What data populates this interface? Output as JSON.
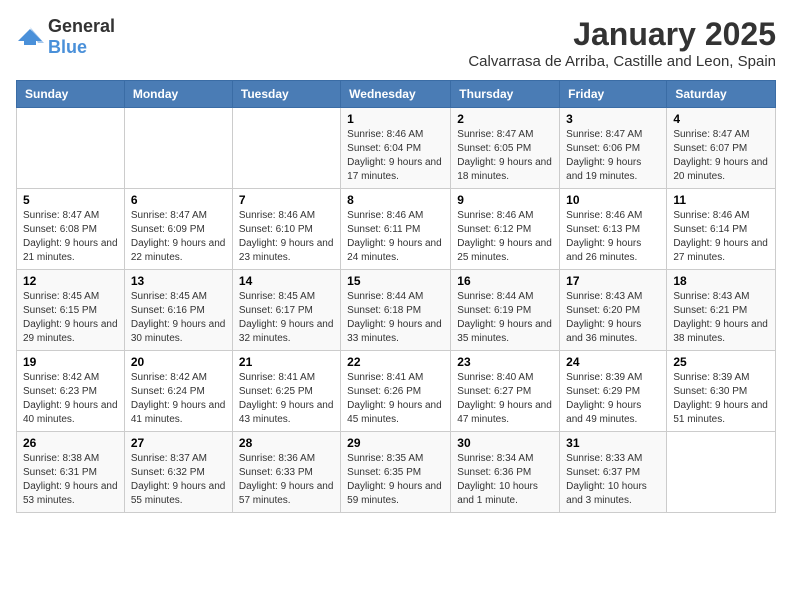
{
  "logo": {
    "general": "General",
    "blue": "Blue"
  },
  "header": {
    "month": "January 2025",
    "location": "Calvarrasa de Arriba, Castille and Leon, Spain"
  },
  "weekdays": [
    "Sunday",
    "Monday",
    "Tuesday",
    "Wednesday",
    "Thursday",
    "Friday",
    "Saturday"
  ],
  "weeks": [
    [
      {
        "day": "",
        "sunrise": "",
        "sunset": "",
        "daylight": ""
      },
      {
        "day": "",
        "sunrise": "",
        "sunset": "",
        "daylight": ""
      },
      {
        "day": "",
        "sunrise": "",
        "sunset": "",
        "daylight": ""
      },
      {
        "day": "1",
        "sunrise": "Sunrise: 8:46 AM",
        "sunset": "Sunset: 6:04 PM",
        "daylight": "Daylight: 9 hours and 17 minutes."
      },
      {
        "day": "2",
        "sunrise": "Sunrise: 8:47 AM",
        "sunset": "Sunset: 6:05 PM",
        "daylight": "Daylight: 9 hours and 18 minutes."
      },
      {
        "day": "3",
        "sunrise": "Sunrise: 8:47 AM",
        "sunset": "Sunset: 6:06 PM",
        "daylight": "Daylight: 9 hours and 19 minutes."
      },
      {
        "day": "4",
        "sunrise": "Sunrise: 8:47 AM",
        "sunset": "Sunset: 6:07 PM",
        "daylight": "Daylight: 9 hours and 20 minutes."
      }
    ],
    [
      {
        "day": "5",
        "sunrise": "Sunrise: 8:47 AM",
        "sunset": "Sunset: 6:08 PM",
        "daylight": "Daylight: 9 hours and 21 minutes."
      },
      {
        "day": "6",
        "sunrise": "Sunrise: 8:47 AM",
        "sunset": "Sunset: 6:09 PM",
        "daylight": "Daylight: 9 hours and 22 minutes."
      },
      {
        "day": "7",
        "sunrise": "Sunrise: 8:46 AM",
        "sunset": "Sunset: 6:10 PM",
        "daylight": "Daylight: 9 hours and 23 minutes."
      },
      {
        "day": "8",
        "sunrise": "Sunrise: 8:46 AM",
        "sunset": "Sunset: 6:11 PM",
        "daylight": "Daylight: 9 hours and 24 minutes."
      },
      {
        "day": "9",
        "sunrise": "Sunrise: 8:46 AM",
        "sunset": "Sunset: 6:12 PM",
        "daylight": "Daylight: 9 hours and 25 minutes."
      },
      {
        "day": "10",
        "sunrise": "Sunrise: 8:46 AM",
        "sunset": "Sunset: 6:13 PM",
        "daylight": "Daylight: 9 hours and 26 minutes."
      },
      {
        "day": "11",
        "sunrise": "Sunrise: 8:46 AM",
        "sunset": "Sunset: 6:14 PM",
        "daylight": "Daylight: 9 hours and 27 minutes."
      }
    ],
    [
      {
        "day": "12",
        "sunrise": "Sunrise: 8:45 AM",
        "sunset": "Sunset: 6:15 PM",
        "daylight": "Daylight: 9 hours and 29 minutes."
      },
      {
        "day": "13",
        "sunrise": "Sunrise: 8:45 AM",
        "sunset": "Sunset: 6:16 PM",
        "daylight": "Daylight: 9 hours and 30 minutes."
      },
      {
        "day": "14",
        "sunrise": "Sunrise: 8:45 AM",
        "sunset": "Sunset: 6:17 PM",
        "daylight": "Daylight: 9 hours and 32 minutes."
      },
      {
        "day": "15",
        "sunrise": "Sunrise: 8:44 AM",
        "sunset": "Sunset: 6:18 PM",
        "daylight": "Daylight: 9 hours and 33 minutes."
      },
      {
        "day": "16",
        "sunrise": "Sunrise: 8:44 AM",
        "sunset": "Sunset: 6:19 PM",
        "daylight": "Daylight: 9 hours and 35 minutes."
      },
      {
        "day": "17",
        "sunrise": "Sunrise: 8:43 AM",
        "sunset": "Sunset: 6:20 PM",
        "daylight": "Daylight: 9 hours and 36 minutes."
      },
      {
        "day": "18",
        "sunrise": "Sunrise: 8:43 AM",
        "sunset": "Sunset: 6:21 PM",
        "daylight": "Daylight: 9 hours and 38 minutes."
      }
    ],
    [
      {
        "day": "19",
        "sunrise": "Sunrise: 8:42 AM",
        "sunset": "Sunset: 6:23 PM",
        "daylight": "Daylight: 9 hours and 40 minutes."
      },
      {
        "day": "20",
        "sunrise": "Sunrise: 8:42 AM",
        "sunset": "Sunset: 6:24 PM",
        "daylight": "Daylight: 9 hours and 41 minutes."
      },
      {
        "day": "21",
        "sunrise": "Sunrise: 8:41 AM",
        "sunset": "Sunset: 6:25 PM",
        "daylight": "Daylight: 9 hours and 43 minutes."
      },
      {
        "day": "22",
        "sunrise": "Sunrise: 8:41 AM",
        "sunset": "Sunset: 6:26 PM",
        "daylight": "Daylight: 9 hours and 45 minutes."
      },
      {
        "day": "23",
        "sunrise": "Sunrise: 8:40 AM",
        "sunset": "Sunset: 6:27 PM",
        "daylight": "Daylight: 9 hours and 47 minutes."
      },
      {
        "day": "24",
        "sunrise": "Sunrise: 8:39 AM",
        "sunset": "Sunset: 6:29 PM",
        "daylight": "Daylight: 9 hours and 49 minutes."
      },
      {
        "day": "25",
        "sunrise": "Sunrise: 8:39 AM",
        "sunset": "Sunset: 6:30 PM",
        "daylight": "Daylight: 9 hours and 51 minutes."
      }
    ],
    [
      {
        "day": "26",
        "sunrise": "Sunrise: 8:38 AM",
        "sunset": "Sunset: 6:31 PM",
        "daylight": "Daylight: 9 hours and 53 minutes."
      },
      {
        "day": "27",
        "sunrise": "Sunrise: 8:37 AM",
        "sunset": "Sunset: 6:32 PM",
        "daylight": "Daylight: 9 hours and 55 minutes."
      },
      {
        "day": "28",
        "sunrise": "Sunrise: 8:36 AM",
        "sunset": "Sunset: 6:33 PM",
        "daylight": "Daylight: 9 hours and 57 minutes."
      },
      {
        "day": "29",
        "sunrise": "Sunrise: 8:35 AM",
        "sunset": "Sunset: 6:35 PM",
        "daylight": "Daylight: 9 hours and 59 minutes."
      },
      {
        "day": "30",
        "sunrise": "Sunrise: 8:34 AM",
        "sunset": "Sunset: 6:36 PM",
        "daylight": "Daylight: 10 hours and 1 minute."
      },
      {
        "day": "31",
        "sunrise": "Sunrise: 8:33 AM",
        "sunset": "Sunset: 6:37 PM",
        "daylight": "Daylight: 10 hours and 3 minutes."
      },
      {
        "day": "",
        "sunrise": "",
        "sunset": "",
        "daylight": ""
      }
    ]
  ]
}
